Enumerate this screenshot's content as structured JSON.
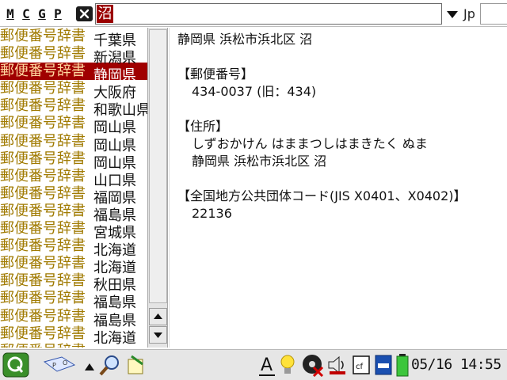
{
  "toolbar": {
    "modes": [
      "M",
      "C",
      "G",
      "P"
    ],
    "clear_icon": "close-icon",
    "search_value": "沼",
    "dropdown_icon": "chevron-down-icon",
    "lang_label": "Jp"
  },
  "results": [
    {
      "dict": "郵便番号辞書",
      "pref": "千葉県"
    },
    {
      "dict": "郵便番号辞書",
      "pref": "新潟県"
    },
    {
      "dict": "郵便番号辞書",
      "pref": "静岡県",
      "selected": true
    },
    {
      "dict": "郵便番号辞書",
      "pref": "大阪府"
    },
    {
      "dict": "郵便番号辞書",
      "pref": "和歌山県"
    },
    {
      "dict": "郵便番号辞書",
      "pref": "岡山県"
    },
    {
      "dict": "郵便番号辞書",
      "pref": "岡山県"
    },
    {
      "dict": "郵便番号辞書",
      "pref": "岡山県"
    },
    {
      "dict": "郵便番号辞書",
      "pref": "山口県"
    },
    {
      "dict": "郵便番号辞書",
      "pref": "福岡県"
    },
    {
      "dict": "郵便番号辞書",
      "pref": "福島県"
    },
    {
      "dict": "郵便番号辞書",
      "pref": "宮城県"
    },
    {
      "dict": "郵便番号辞書",
      "pref": "北海道"
    },
    {
      "dict": "郵便番号辞書",
      "pref": "北海道"
    },
    {
      "dict": "郵便番号辞書",
      "pref": "秋田県"
    },
    {
      "dict": "郵便番号辞書",
      "pref": "福島県"
    },
    {
      "dict": "郵便番号辞書",
      "pref": "福島県"
    },
    {
      "dict": "郵便番号辞書",
      "pref": "北海道"
    },
    {
      "dict": "郵便番号辞書",
      "pref": "青森県"
    }
  ],
  "detail": {
    "title": "静岡県 浜松市浜北区 沼",
    "postal_heading": "【郵便番号】",
    "postal_value": "434-0037 (旧：434)",
    "address_heading": "【住所】",
    "address_kana": "しずおかけん はままつしはまきたく ぬま",
    "address_kanji": "静岡県 浜松市浜北区 沼",
    "code_heading": "【全国地方公共団体コード(JIS X0401、X0402)】",
    "code_value": "22136"
  },
  "taskbar": {
    "clock": "05/16 14:55",
    "icons": [
      "q-logo-icon",
      "input-panel-icon",
      "up-arrow-icon",
      "search-tool-icon",
      "app-icon",
      "font-a-icon",
      "lightbulb-icon",
      "network-disabled-icon",
      "speaker-icon",
      "cf-card-icon",
      "sd-card-icon",
      "battery-icon"
    ]
  },
  "colors": {
    "selection": "#a00000",
    "dict_text": "#a07a00",
    "search_highlight": "#9b0000"
  }
}
